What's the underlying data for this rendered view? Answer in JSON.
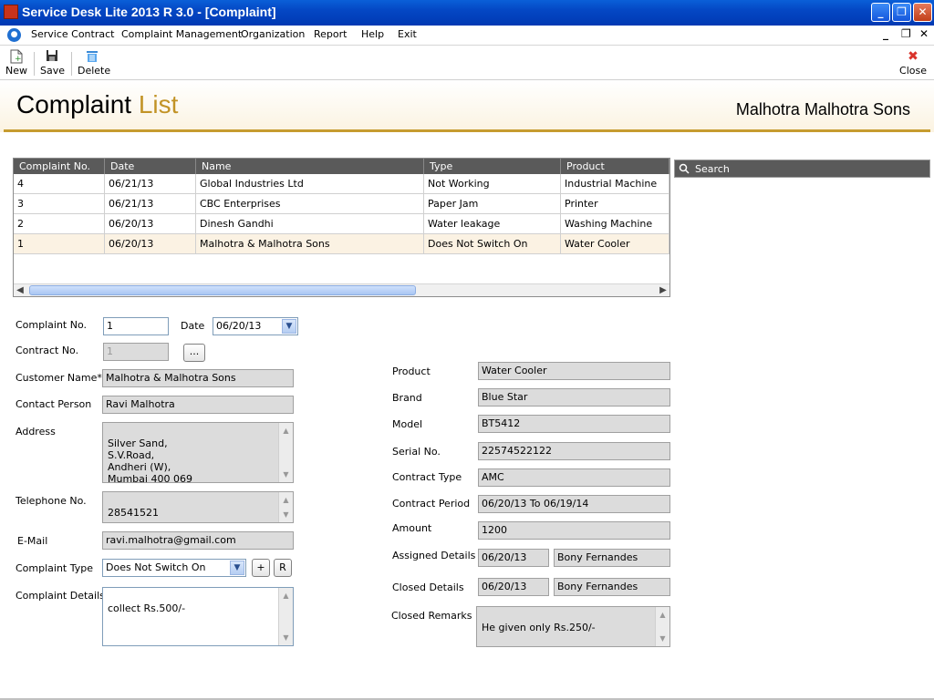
{
  "window": {
    "title": "Service Desk Lite 2013 R 3.0 - [Complaint]",
    "minimize": "_",
    "maximize": "❐",
    "close": "✕"
  },
  "menu": {
    "items": [
      "Service Contract",
      "Complaint Management",
      "Organization",
      "Report",
      "Help",
      "Exit"
    ],
    "mdi_minimize": "_",
    "mdi_restore": "❐",
    "mdi_close": "✕"
  },
  "toolbar": {
    "new_label": "New",
    "save_label": "Save",
    "delete_label": "Delete",
    "close_label": "Close"
  },
  "header": {
    "title_part1": "Complaint",
    "title_part2": "List",
    "company": "Malhotra  Malhotra Sons"
  },
  "grid": {
    "columns": [
      "Complaint No.",
      "Date",
      "Name",
      "Type",
      "Product"
    ],
    "rows": [
      [
        "4",
        "06/21/13",
        "Global Industries Ltd",
        "Not Working",
        "Industrial Machine"
      ],
      [
        "3",
        "06/21/13",
        "CBC Enterprises",
        "Paper Jam",
        "Printer"
      ],
      [
        "2",
        "06/20/13",
        "Dinesh Gandhi",
        "Water leakage",
        "Washing Machine"
      ],
      [
        "1",
        "06/20/13",
        "Malhotra & Malhotra Sons",
        "Does Not Switch On",
        "Water Cooler"
      ]
    ],
    "selected_row": 3
  },
  "search": {
    "placeholder": "Search"
  },
  "form": {
    "complaint_no_label": "Complaint No.",
    "complaint_no": "1",
    "date_label": "Date",
    "date": "06/20/13",
    "contract_no_label": "Contract No.",
    "contract_no": "1",
    "browse_label": "...",
    "customer_name_label": "Customer Name*",
    "customer_name": "Malhotra & Malhotra Sons",
    "contact_person_label": "Contact Person",
    "contact_person": "Ravi Malhotra",
    "address_label": "Address",
    "address": "Silver Sand,\nS.V.Road,\nAndheri (W),\nMumbai 400 069",
    "telephone_label": "Telephone No.",
    "telephone": "28541521",
    "email_label": "E-Mail",
    "email": "ravi.malhotra@gmail.com",
    "complaint_type_label": "Complaint Type",
    "complaint_type": "Does Not Switch On",
    "add_type_label": "+",
    "refresh_type_label": "R",
    "complaint_details_label": "Complaint Details",
    "complaint_details": "collect Rs.500/-",
    "product_label": "Product",
    "product": "Water Cooler",
    "brand_label": "Brand",
    "brand": "Blue Star",
    "model_label": "Model",
    "model": "BT5412",
    "serial_label": "Serial No.",
    "serial": "22574522122",
    "contract_type_label": "Contract Type",
    "contract_type": "AMC",
    "contract_period_label": "Contract Period",
    "contract_period": "06/20/13 To 06/19/14",
    "amount_label": "Amount",
    "amount": "1200",
    "assigned_label": "Assigned Details",
    "assigned_date": "06/20/13",
    "assigned_person": "Bony Fernandes",
    "closed_label": "Closed Details",
    "closed_date": "06/20/13",
    "closed_person": "Bony Fernandes",
    "closed_remarks_label": "Closed Remarks",
    "closed_remarks": "He given only Rs.250/-"
  }
}
